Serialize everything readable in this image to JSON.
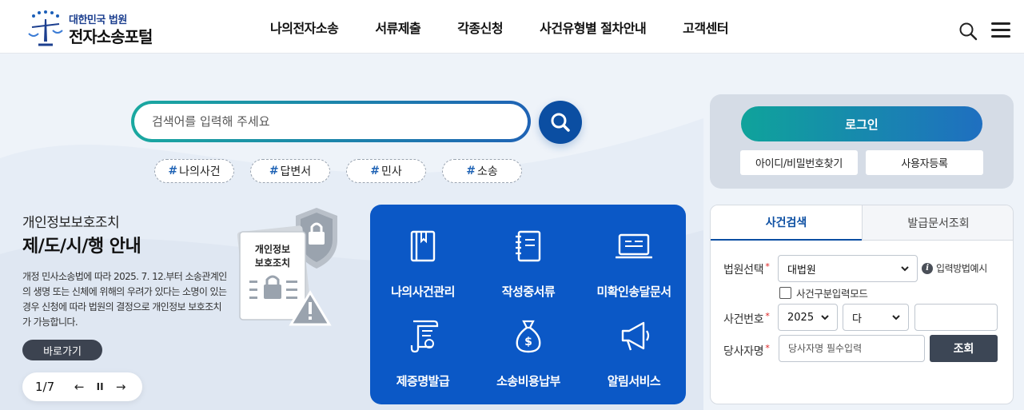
{
  "header": {
    "logo_sub": "대한민국 법원",
    "logo_main": "전자소송포털",
    "nav": [
      "나의전자소송",
      "서류제출",
      "각종신청",
      "사건유형별 절차안내",
      "고객센터"
    ]
  },
  "search": {
    "placeholder": "검색어를 입력해 주세요",
    "tags": [
      "나의사건",
      "답변서",
      "민사",
      "소송"
    ]
  },
  "notice": {
    "subtitle": "개인정보보호조치",
    "title": "제/도/시/행 안내",
    "body": "개정 민사소송법에 따라 2025. 7. 12.부터 소송관계인의 생명 또는 신체에 위해의 우려가 있다는 소명이 있는 경우 신청에 따라 법원의 결정으로 개인정보 보호조치가 가능합니다.",
    "doc_label": "개인정보\n보호조치",
    "go_button": "바로가기",
    "pager": "1/7"
  },
  "quick_menu": [
    {
      "label": "나의사건관리",
      "icon": "book-icon"
    },
    {
      "label": "작성중서류",
      "icon": "notebook-icon"
    },
    {
      "label": "미확인송달문서",
      "icon": "monitor-icon"
    },
    {
      "label": "제증명발급",
      "icon": "certificate-icon"
    },
    {
      "label": "소송비용납부",
      "icon": "money-bag-icon"
    },
    {
      "label": "알림서비스",
      "icon": "megaphone-icon"
    }
  ],
  "login": {
    "login_button": "로그인",
    "find_button": "아이디/비밀번호찾기",
    "register_button": "사용자등록"
  },
  "case_search": {
    "tabs": [
      "사건검색",
      "발급문서조회"
    ],
    "court_label": "법원선택",
    "court_value": "대법원",
    "help_text": "입력방법예시",
    "checkbox_label": "사건구분입력모드",
    "case_no_label": "사건번호",
    "year_value": "2025",
    "type_value": "다",
    "party_label": "당사자명",
    "party_placeholder": "당사자명 필수입력",
    "query_button": "조회"
  },
  "colors": {
    "primary_blue": "#0b58c6",
    "dark_blue": "#0b4ea2",
    "teal": "#0fa39b",
    "background": "#eef3f9"
  }
}
